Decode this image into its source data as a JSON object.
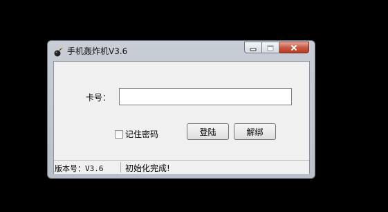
{
  "window": {
    "title": "手机轰炸机V3.6",
    "icon": "bomb-icon",
    "close_color": "#c95b45"
  },
  "form": {
    "card_label": "卡号：",
    "card_value": "",
    "remember_label": "记住密码",
    "remember_checked": false,
    "login_label": "登陆",
    "unbind_label": "解绑"
  },
  "status": {
    "version": "版本号：V3.6",
    "message": "初始化完成!"
  }
}
